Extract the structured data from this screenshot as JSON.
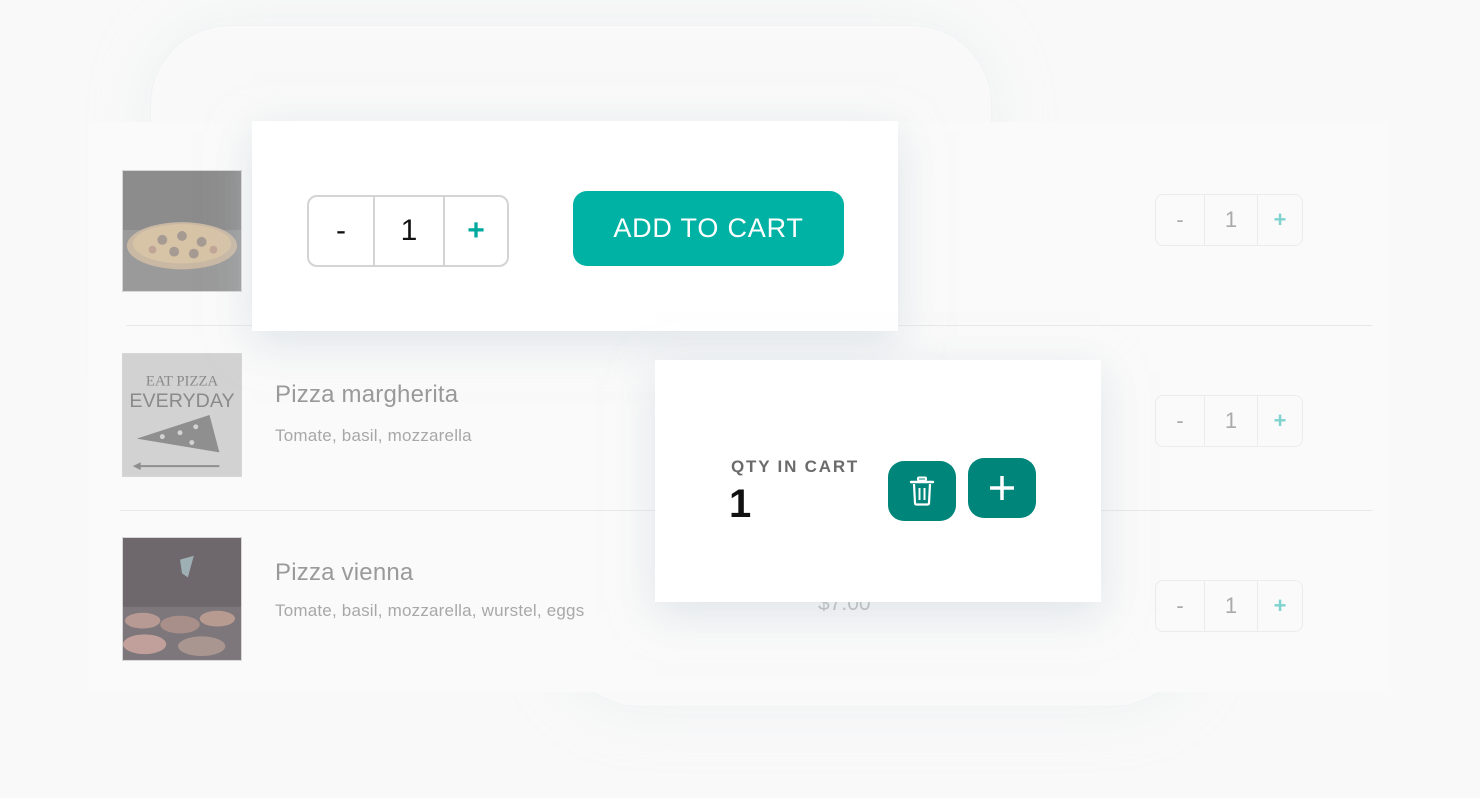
{
  "colors": {
    "accent": "#00b2a4",
    "accent_dark": "#00857a",
    "plus_faded": "#7fd3cd"
  },
  "products": [
    {
      "name": "",
      "description": "",
      "image_icon": "pizza-pepperoni-photo",
      "quantity": "1"
    },
    {
      "name": "Pizza margherita",
      "description": "Tomate, basil, mozzarella",
      "image_icon": "eat-pizza-everyday-poster",
      "image_text_line1": "EAT PIZZA",
      "image_text_line2": "EVERYDAY",
      "quantity": "1"
    },
    {
      "name": "Pizza vienna",
      "description": "Tomate, basil, mozzarella, wurstel, eggs",
      "image_icon": "pizza-oven-photo",
      "price": "$7.00",
      "quantity": "1"
    }
  ],
  "stepper": {
    "minus_label": "-",
    "plus_label": "+"
  },
  "add_to_cart_card": {
    "quantity": "1",
    "minus_label": "-",
    "plus_label": "+",
    "button_label": "ADD TO CART"
  },
  "cart_card": {
    "label": "QTY IN CART",
    "quantity": "1",
    "delete_icon": "trash-icon",
    "add_icon": "plus-icon"
  }
}
